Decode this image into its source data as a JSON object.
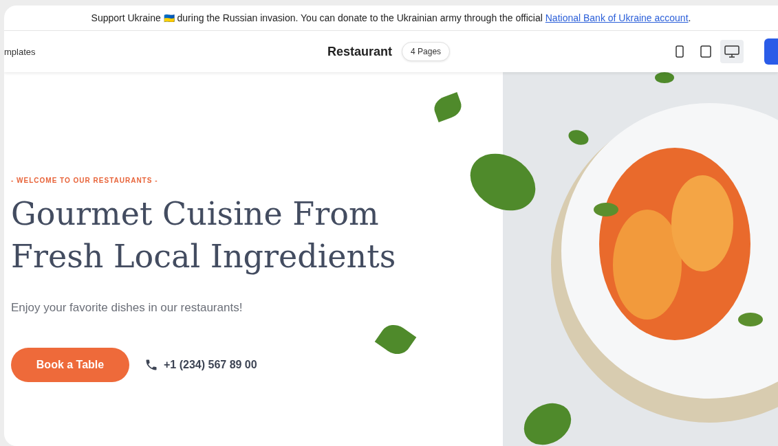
{
  "banner": {
    "text": "Support Ukraine",
    "flag": "🇺🇦",
    "text_after": "during the Russian invasion. You can donate to the Ukrainian army through the official",
    "link": "National Bank of Ukraine account",
    "end": "."
  },
  "toolbar": {
    "left_link": "mplates",
    "title": "Restaurant",
    "pages_badge": "4 Pages",
    "devices": [
      {
        "kind": "phone",
        "selected": false
      },
      {
        "kind": "tablet",
        "selected": false
      },
      {
        "kind": "desktop",
        "selected": true
      }
    ]
  },
  "hero": {
    "eyebrow": "- WELCOME TO OUR RESTAURANTS -",
    "heading_lines": [
      "Gourmet Cuisine From",
      "Fresh Local Ingredients"
    ],
    "subtitle": "Enjoy your favorite dishes in our restaurants!",
    "cta": "Book a Table",
    "phone": "+1 (234) 567 89 00"
  }
}
